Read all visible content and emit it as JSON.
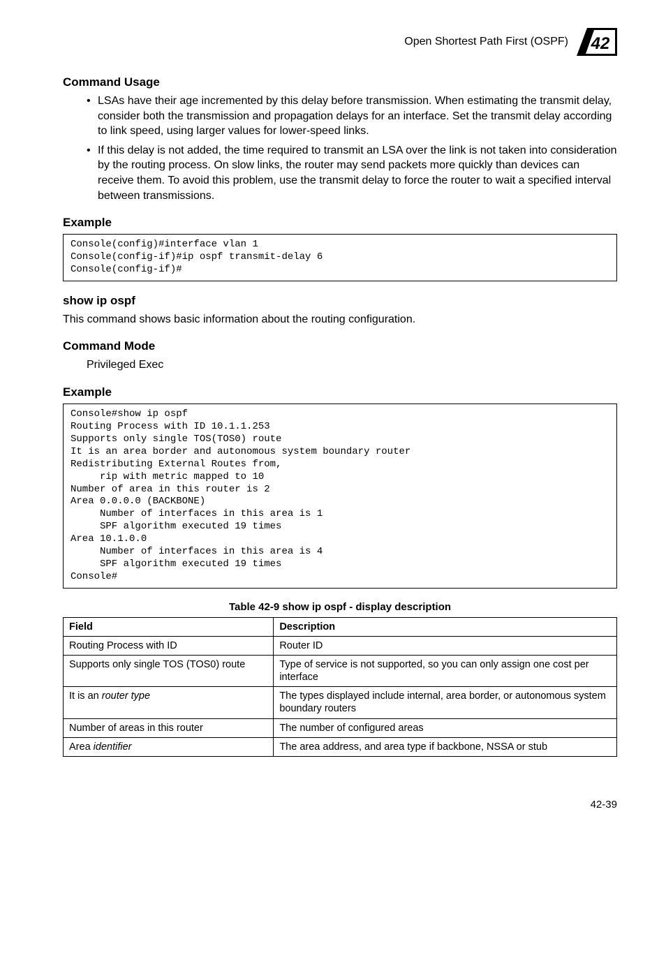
{
  "header": {
    "breadcrumb": "Open Shortest Path First (OSPF)",
    "chapter_number": "42"
  },
  "sections": {
    "command_usage": {
      "title": "Command Usage",
      "bullets": [
        "LSAs have their age incremented by this delay before transmission. When estimating the transmit delay, consider both the transmission and propagation delays for an interface. Set the transmit delay according to link speed, using larger values for lower-speed links.",
        "If this delay is not added, the time required to transmit an LSA over the link is not taken into consideration by the routing process. On slow links, the router may send packets more quickly than devices can receive them. To avoid this problem, use the transmit delay to force the router to wait a specified interval between transmissions."
      ]
    },
    "example1": {
      "title": "Example",
      "code": "Console(config)#interface vlan 1\nConsole(config-if)#ip ospf transmit-delay 6\nConsole(config-if)#"
    },
    "show_ip_ospf": {
      "title": "show ip ospf",
      "description": "This command shows basic information about the routing configuration."
    },
    "command_mode": {
      "title": "Command Mode",
      "value": "Privileged Exec"
    },
    "example2": {
      "title": "Example",
      "code": "Console#show ip ospf\nRouting Process with ID 10.1.1.253\nSupports only single TOS(TOS0) route\nIt is an area border and autonomous system boundary router\nRedistributing External Routes from,\n     rip with metric mapped to 10\nNumber of area in this router is 2\nArea 0.0.0.0 (BACKBONE)\n     Number of interfaces in this area is 1\n     SPF algorithm executed 19 times\nArea 10.1.0.0\n     Number of interfaces in this area is 4\n     SPF algorithm executed 19 times\nConsole#"
    },
    "table": {
      "caption": "Table 42-9   show ip ospf - display description",
      "headers": [
        "Field",
        "Description"
      ],
      "rows": [
        {
          "field": "Routing Process with ID",
          "field_ital": "",
          "desc": "Router ID"
        },
        {
          "field": "Supports only single TOS (TOS0) route",
          "field_ital": "",
          "desc": "Type of service is not supported, so you can only assign one cost per interface"
        },
        {
          "field": "It is an ",
          "field_ital": "router type",
          "desc": "The types displayed include internal, area border, or autonomous system boundary routers"
        },
        {
          "field": "Number of areas in this router",
          "field_ital": "",
          "desc": "The number of configured areas"
        },
        {
          "field": "Area ",
          "field_ital": "identifier",
          "desc": "The area address, and area type if backbone, NSSA or stub"
        }
      ]
    }
  },
  "footer": {
    "page_number": "42-39"
  }
}
